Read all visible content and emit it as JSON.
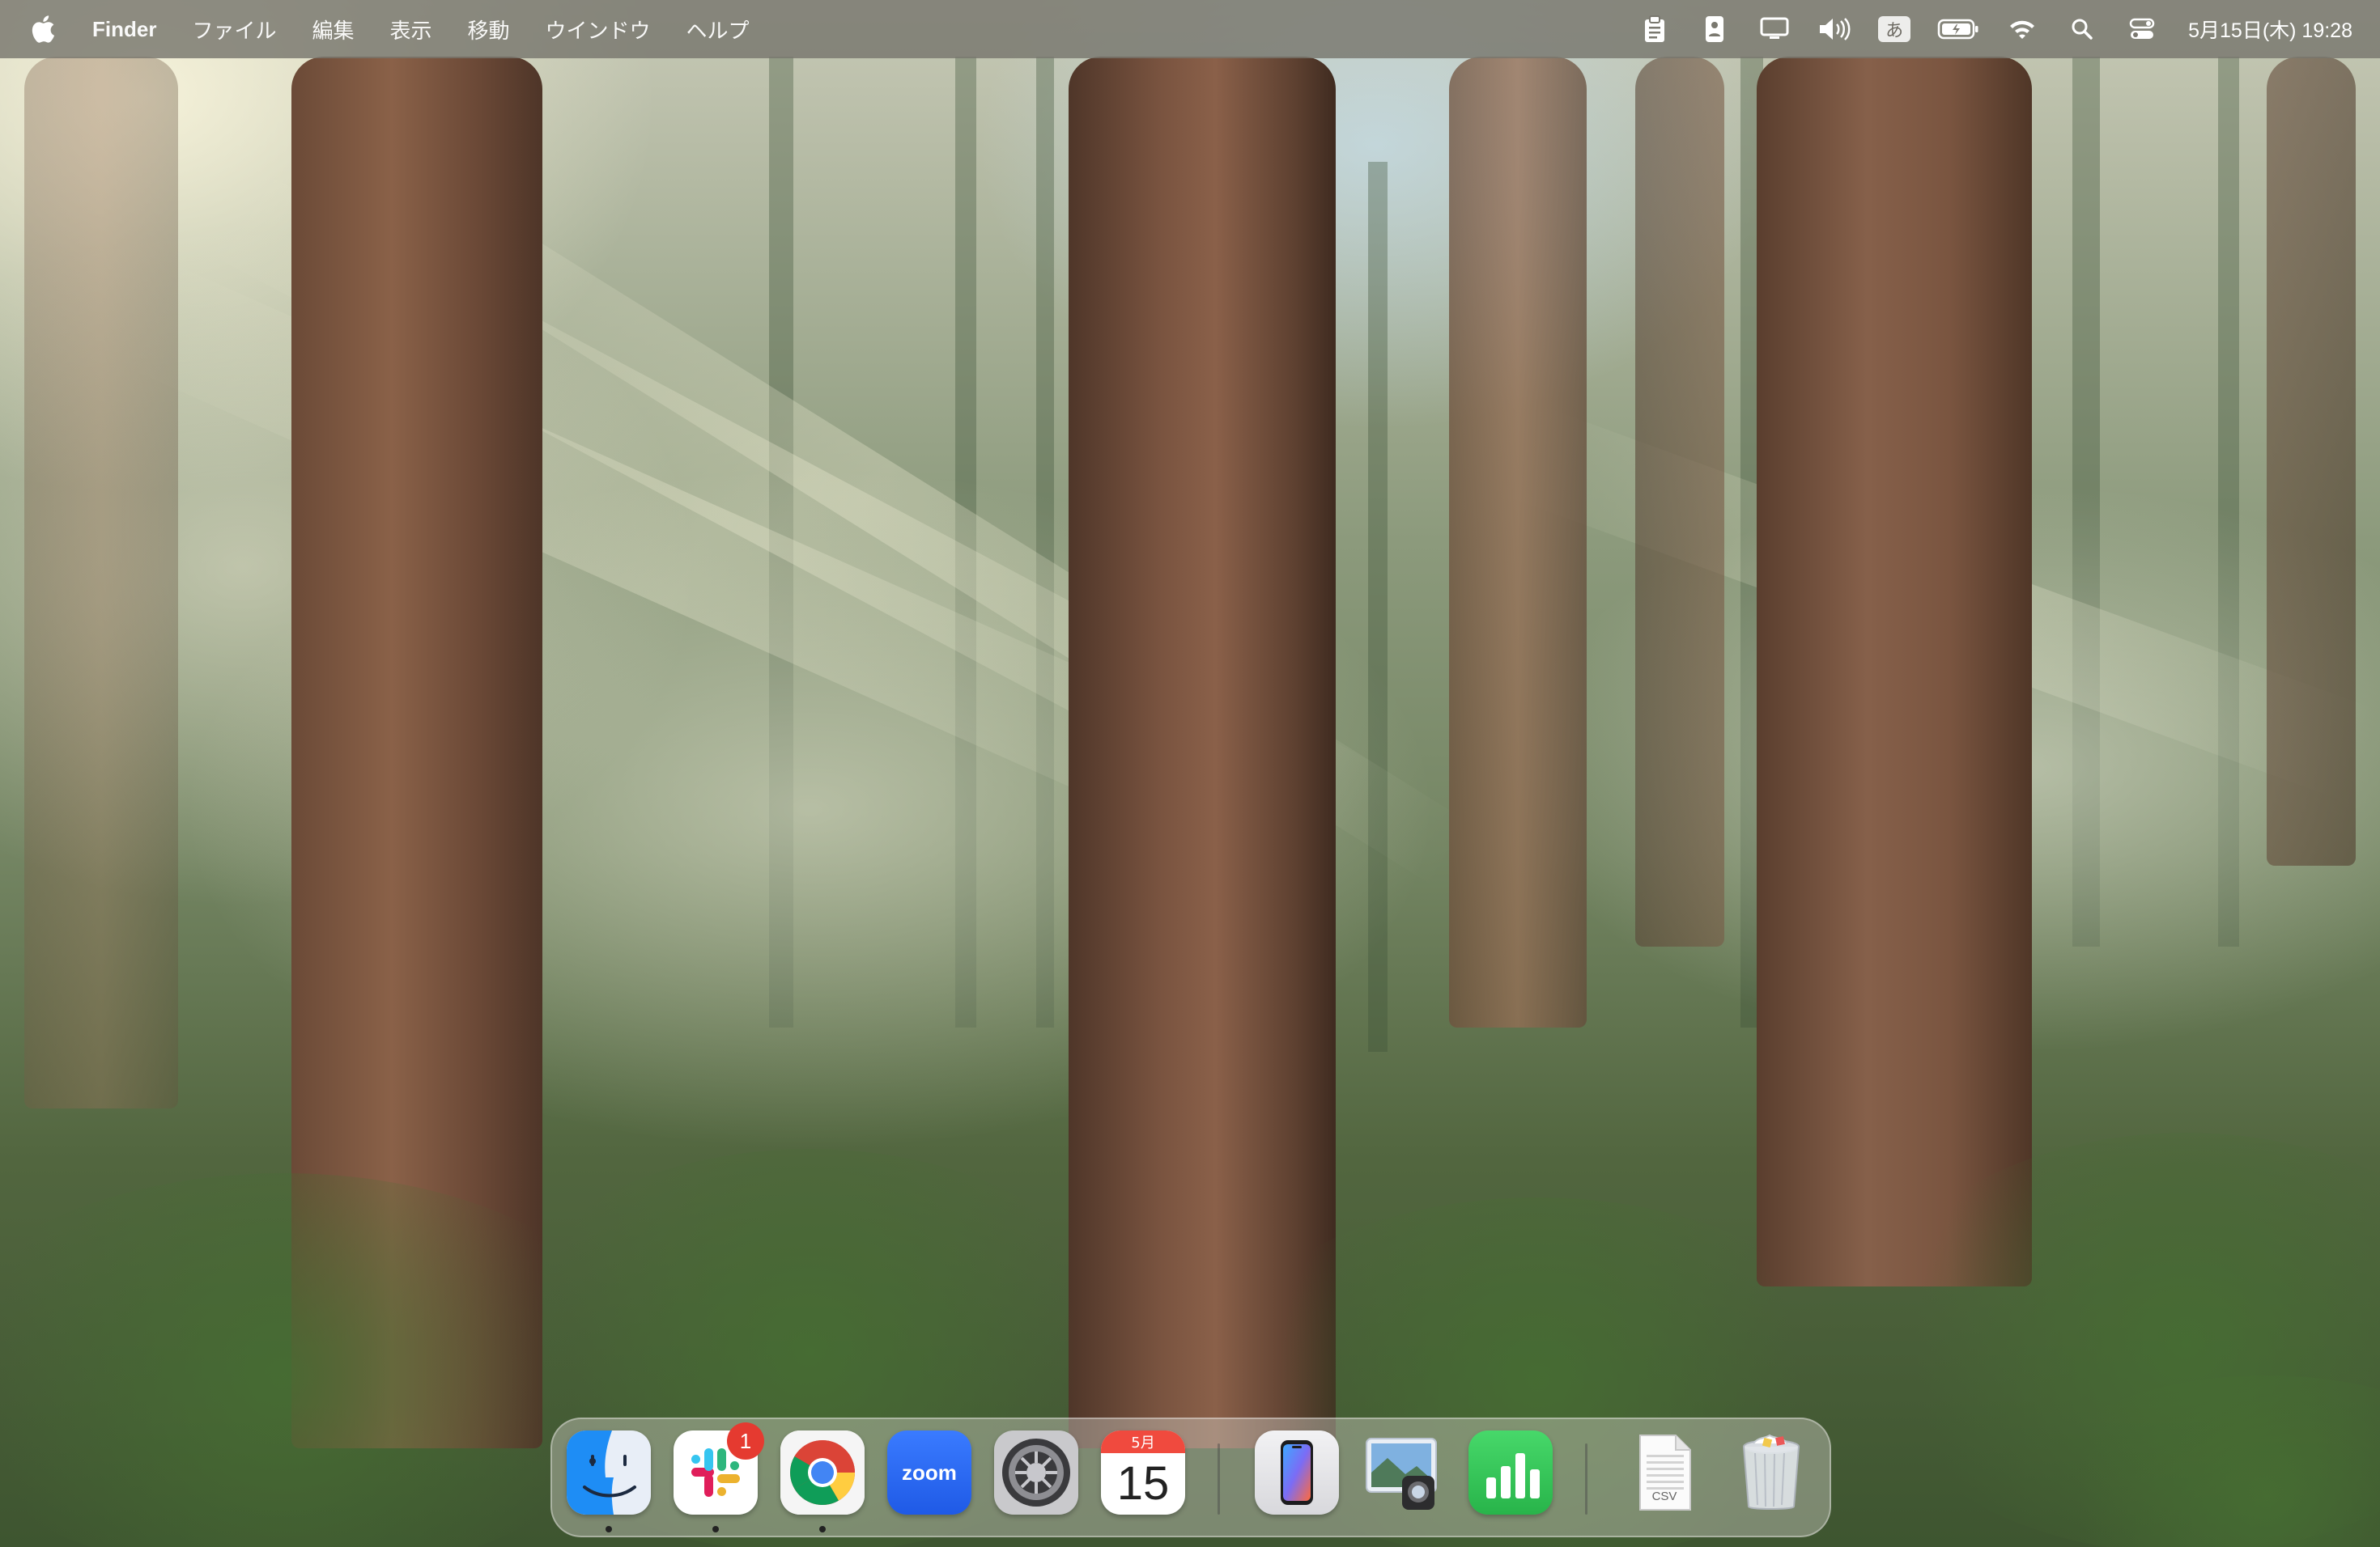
{
  "menubar": {
    "apple_icon": "apple-logo-icon",
    "app_name": "Finder",
    "menus": [
      "ファイル",
      "編集",
      "表示",
      "移動",
      "ウインドウ",
      "ヘルプ"
    ],
    "status_icons": [
      "clipboard-icon",
      "contact-card-icon",
      "display-icon",
      "volume-icon",
      "input-method-icon",
      "battery-icon",
      "wifi-icon",
      "spotlight-icon",
      "control-center-icon"
    ],
    "input_method_label": "あ",
    "clock": "5月15日(木)  19:28"
  },
  "dock": {
    "apps": [
      {
        "name": "Finder",
        "icon": "finder-icon",
        "running": true
      },
      {
        "name": "Slack",
        "icon": "slack-icon",
        "running": true,
        "badge": "1"
      },
      {
        "name": "Google Chrome",
        "icon": "chrome-icon",
        "running": true
      },
      {
        "name": "zoom",
        "icon": "zoom-icon",
        "label": "zoom",
        "running": false
      },
      {
        "name": "System Settings",
        "icon": "system-settings-icon",
        "running": false
      },
      {
        "name": "Calendar",
        "icon": "calendar-icon",
        "month": "5月",
        "day": "15",
        "running": false
      }
    ],
    "recent_apps": [
      {
        "name": "iPhone Mirroring",
        "icon": "iphone-mirroring-icon"
      },
      {
        "name": "Preview",
        "icon": "preview-icon"
      },
      {
        "name": "Numbers",
        "icon": "numbers-icon"
      }
    ],
    "stack": {
      "name": "CSV file",
      "icon": "csv-document-icon",
      "label": "CSV"
    },
    "trash": {
      "name": "Trash",
      "icon": "trash-icon"
    }
  },
  "colors": {
    "menubar_bg": "#787670",
    "badge": "#e53a30",
    "zoom_blue": "#2d68f6",
    "numbers_green": "#35c759",
    "calendar_red": "#f04a3e"
  }
}
